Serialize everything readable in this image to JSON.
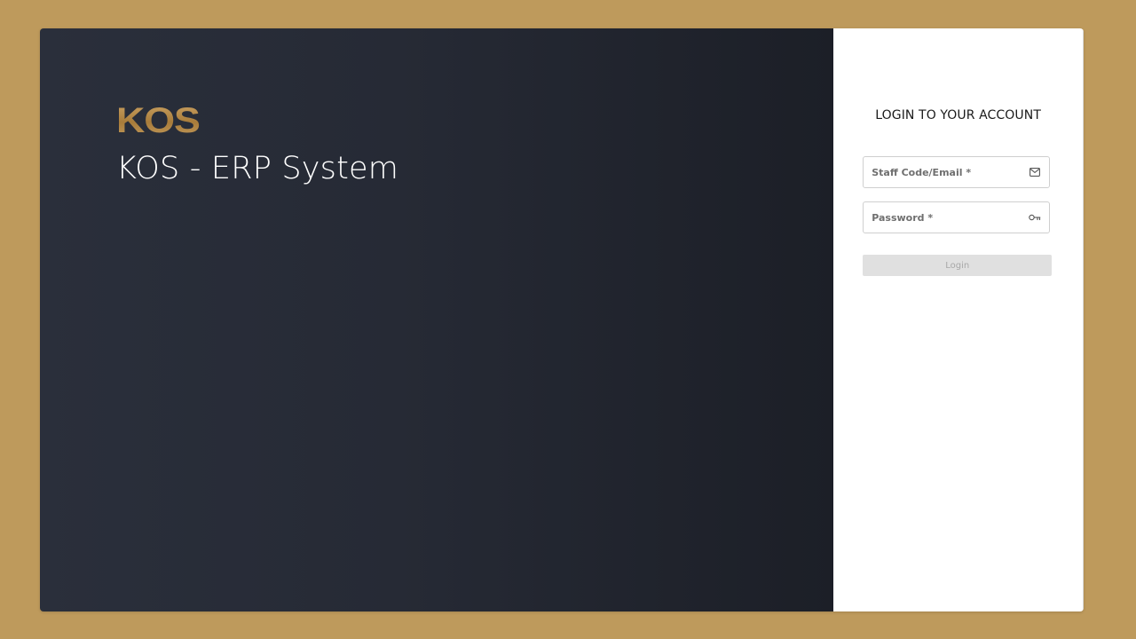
{
  "brand": {
    "logo_text": "KOS",
    "system_title": "KOS - ERP System"
  },
  "login": {
    "heading": "LOGIN TO YOUR ACCOUNT",
    "email_field": {
      "placeholder": "Staff Code/Email *",
      "value": "",
      "icon": "envelope-icon"
    },
    "password_field": {
      "placeholder": "Password *",
      "value": "",
      "icon": "key-icon"
    },
    "submit_label": "Login",
    "submit_disabled": true
  },
  "colors": {
    "background": "#be9a5c",
    "hero_start": "#2a2f3b",
    "hero_end": "#1c1f27",
    "logo_gold": "#b48a45",
    "button_disabled_bg": "#e0e0e0",
    "button_disabled_text": "#a8a8a8"
  }
}
